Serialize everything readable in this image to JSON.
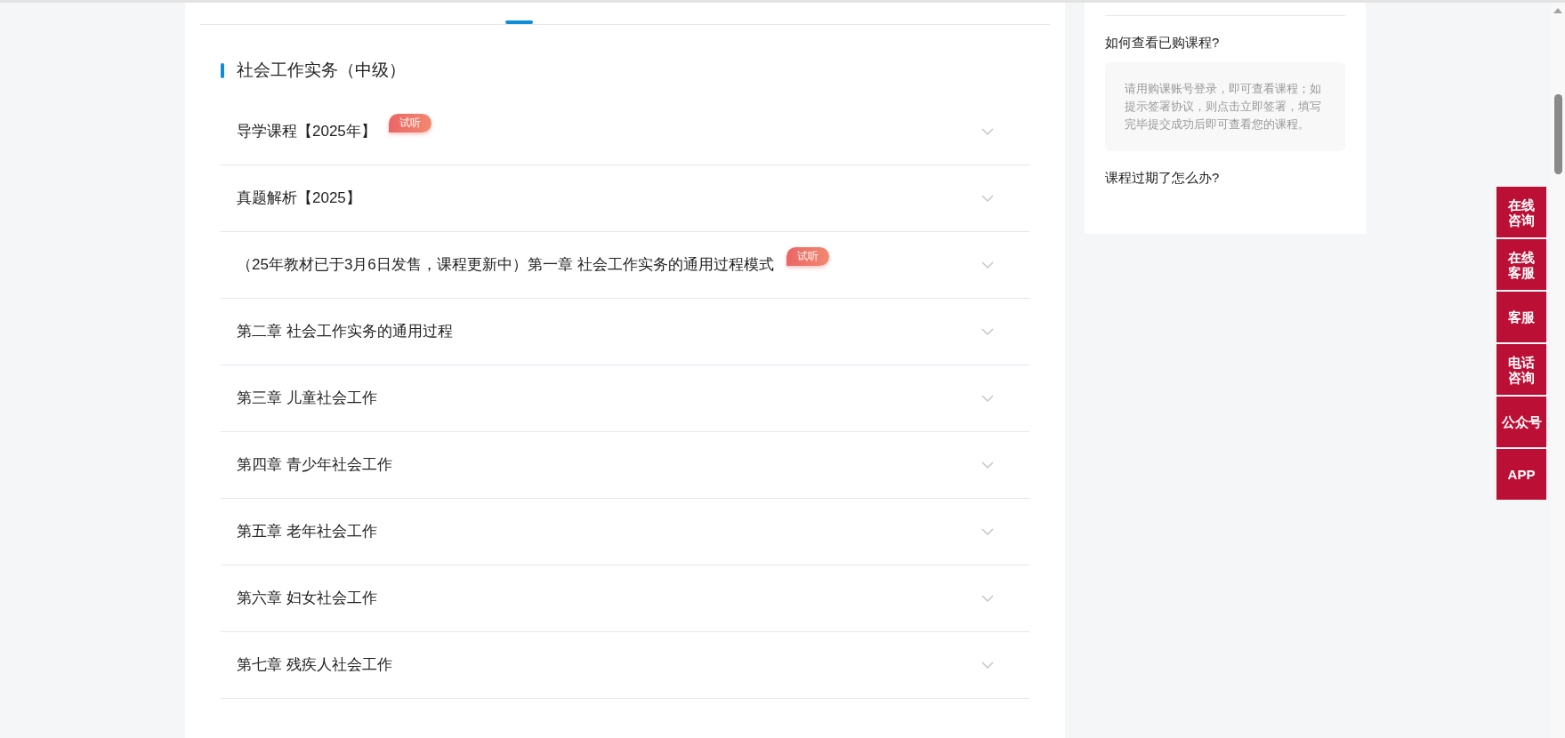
{
  "section": {
    "title": "社会工作实务（中级）"
  },
  "chapters": [
    {
      "title": "导学课程【2025年】",
      "badge": "试听",
      "expanded": false
    },
    {
      "title": "真题解析【2025】",
      "expanded": false
    },
    {
      "title": "（25年教材已于3月6日发售，课程更新中）第一章 社会工作实务的通用过程模式",
      "badge": "试听",
      "expanded": false
    },
    {
      "title": "第二章 社会工作实务的通用过程",
      "expanded": false
    },
    {
      "title": "第三章 儿童社会工作",
      "expanded": false
    },
    {
      "title": "第四章 青少年社会工作",
      "expanded": false
    },
    {
      "title": "第五章 老年社会工作",
      "expanded": false
    },
    {
      "title": "第六章 妇女社会工作",
      "expanded": false
    },
    {
      "title": "第七章 残疾人社会工作",
      "expanded": false
    }
  ],
  "faq": [
    {
      "question": "如何查看已购课程?",
      "answer": "请用购课账号登录，即可查看课程；如提示签署协议，则点击立即签署，填写完毕提交成功后即可查看您的课程。"
    },
    {
      "question": "课程过期了怎么办?"
    }
  ],
  "side_buttons": [
    {
      "lines": [
        "在线",
        "咨询"
      ]
    },
    {
      "lines": [
        "在线",
        "客服"
      ]
    },
    {
      "lines": [
        "客服"
      ]
    },
    {
      "lines": [
        "电话",
        "咨询"
      ]
    },
    {
      "lines": [
        "公众号"
      ]
    },
    {
      "lines": [
        "APP"
      ]
    }
  ]
}
